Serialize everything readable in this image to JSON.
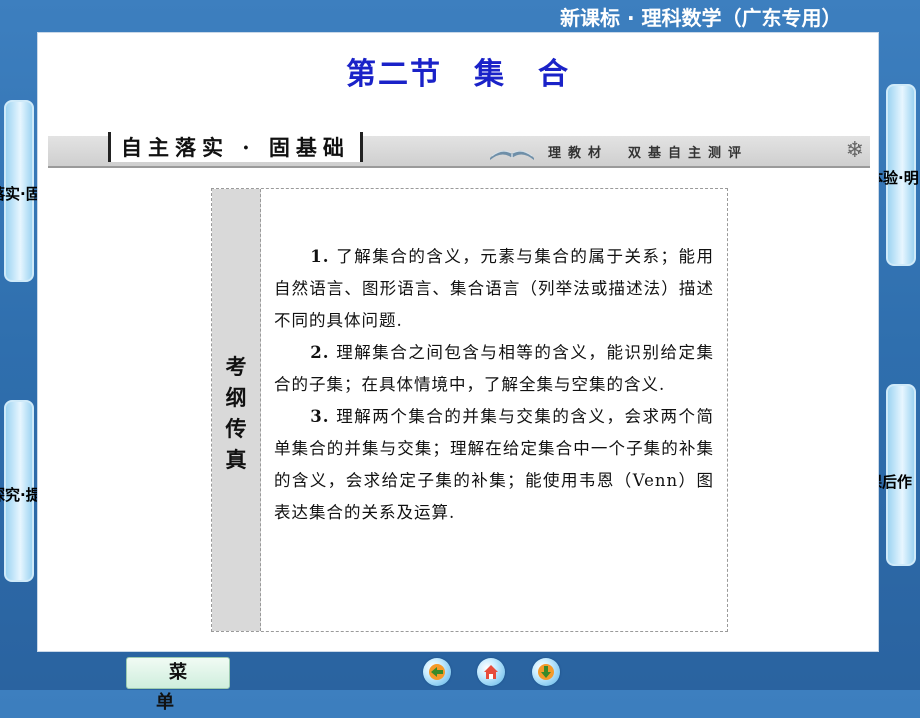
{
  "header": {
    "series": "新课标 · 理科数学（广东专用）"
  },
  "slide": {
    "title": "第二节　集　合"
  },
  "banner": {
    "tab": "自主落实 · 固基础",
    "subtitle": "理教材　双基自主测评"
  },
  "content": {
    "side_label": [
      "考",
      "纲",
      "传",
      "真"
    ],
    "items": [
      {
        "num": "1.",
        "text": " 了解集合的含义，元素与集合的属于关系；能用自然语言、图形语言、集合语言（列举法或描述法）描述不同的具体问题."
      },
      {
        "num": "2.",
        "text": " 理解集合之间包含与相等的含义，能识别给定集合的子集；在具体情境中，了解全集与空集的含义."
      },
      {
        "num": "3.",
        "text": " 理解两个集合的并集与交集的含义，会求两个简单集合的并集与交集；理解在给定集合中一个子集的补集的含义，会求给定子集的补集；能使用韦恩（Venn）图表达集合的关系及运算."
      }
    ]
  },
  "nav": {
    "left_top": "落实·固基础",
    "left_bottom": "探究·提知能",
    "right_top": "高考体验·明",
    "right_bottom": "课后作"
  },
  "footer": {
    "menu_label": "菜单",
    "icons": [
      "back-icon",
      "home-icon",
      "forward-icon"
    ]
  }
}
